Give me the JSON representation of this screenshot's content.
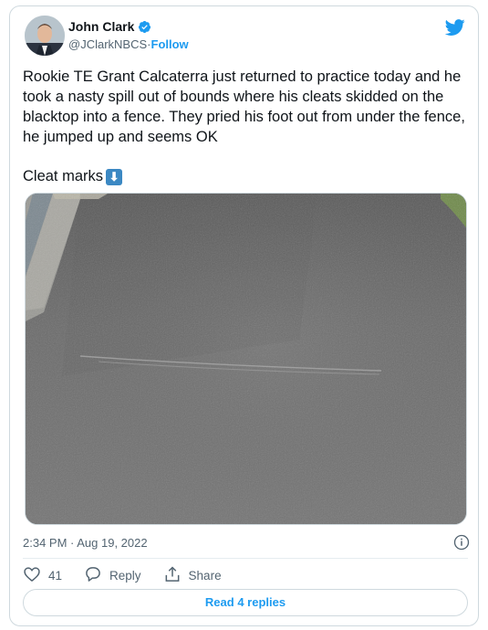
{
  "author": {
    "name": "John Clark",
    "handle": "@JClarkNBCS",
    "separator": " · ",
    "follow_label": "Follow",
    "verified_icon": "verified-badge-icon"
  },
  "brand_icon": "twitter-bird-icon",
  "tweet": {
    "text": "Rookie TE Grant Calcaterra just returned to practice today and he took a nasty spill out of bounds where his cleats skidded on the blacktop into a fence. They pried his foot out from under the fence, he jumped up and seems OK",
    "line2": "Cleat marks",
    "emoji": "⬇",
    "emoji_icon": "down-arrow-emoji-icon"
  },
  "media": {
    "description_icon": "asphalt-photo"
  },
  "timestamp": "2:34 PM · Aug 19, 2022",
  "actions": {
    "like_count": "41",
    "reply_label": "Reply",
    "share_label": "Share"
  },
  "read_replies_label": "Read 4 replies",
  "colors": {
    "accent": "#1d9bf0",
    "text": "#0f1419",
    "muted": "#536471",
    "border": "#cfd9de"
  }
}
